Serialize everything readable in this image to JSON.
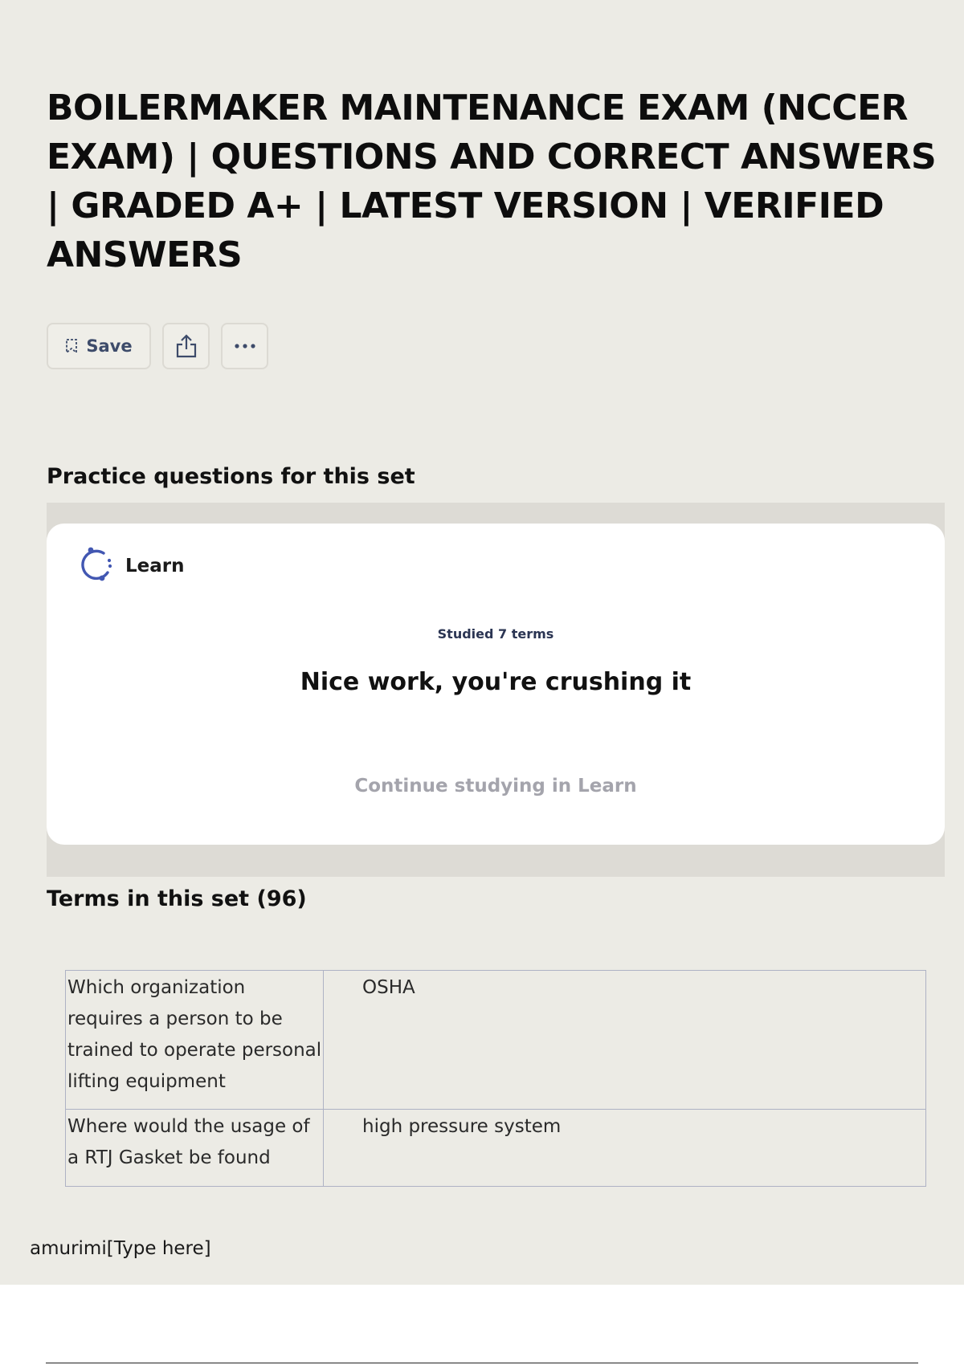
{
  "title": "BOILERMAKER MAINTENANCE EXAM (NCCER EXAM) | QUESTIONS AND CORRECT ANSWERS | GRADED A+ | LATEST VERSION | VERIFIED ANSWERS",
  "toolbar": {
    "save_label": "Save",
    "icons": [
      "bookmark-icon",
      "share-icon",
      "more-icon"
    ]
  },
  "practice": {
    "heading": "Practice questions for this set",
    "card": {
      "label": "Learn",
      "icon": "learn-progress-icon",
      "studied": "Studied 7 terms",
      "message": "Nice work, you're crushing it",
      "continue_label": "Continue studying in Learn"
    }
  },
  "terms": {
    "heading": "Terms in this set (96)",
    "rows": [
      {
        "term": "Which organization requires a person to be trained to operate personal lifting equipment",
        "definition": "OSHA"
      },
      {
        "term": "Where would the usage of a RTJ Gasket be found",
        "definition": "high pressure system"
      }
    ]
  },
  "footer": {
    "text": "amurimi[Type here]"
  },
  "colors": {
    "page_background": "#ecebe5",
    "card_background": "#ffffff",
    "accent": "#4257b2",
    "link_muted": "#a4a4ac"
  }
}
